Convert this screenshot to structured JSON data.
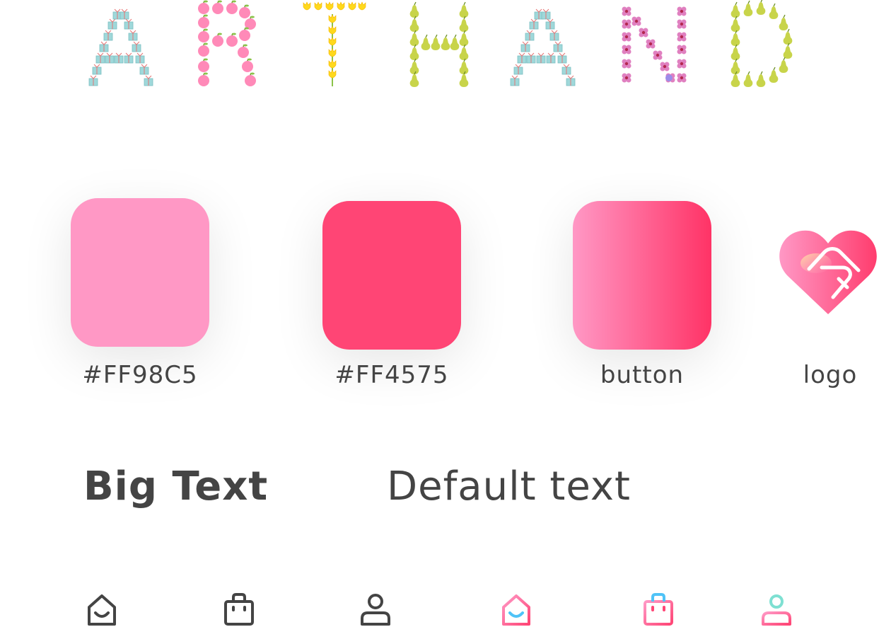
{
  "banner": {
    "letters": [
      "A",
      "R",
      "T",
      "H",
      "A",
      "N",
      "D"
    ],
    "decorations": [
      "gift-box",
      "apple",
      "tulip",
      "pear",
      "gift-box",
      "orchid",
      "pear"
    ]
  },
  "swatches": [
    {
      "label": "#FF98C5",
      "color": "#FF98C5"
    },
    {
      "label": "#FF4575",
      "color": "#FF4575"
    },
    {
      "label": "button",
      "gradient_from": "#FF98C5",
      "gradient_to": "#FF3366"
    }
  ],
  "logo": {
    "label": "logo",
    "icon": "handshake-heart-icon"
  },
  "typography": {
    "big": "Big Text",
    "default": "Default text"
  },
  "icons": [
    {
      "name": "home-icon",
      "state": "default"
    },
    {
      "name": "bag-icon",
      "state": "default"
    },
    {
      "name": "user-icon",
      "state": "default"
    },
    {
      "name": "home-icon",
      "state": "active"
    },
    {
      "name": "bag-icon",
      "state": "active"
    },
    {
      "name": "user-icon",
      "state": "active"
    }
  ],
  "colors": {
    "text": "#444444",
    "pink_light": "#FF98C5",
    "pink_dark": "#FF4575",
    "blue_accent": "#4FC3F7",
    "teal_accent": "#7EE0D2"
  }
}
